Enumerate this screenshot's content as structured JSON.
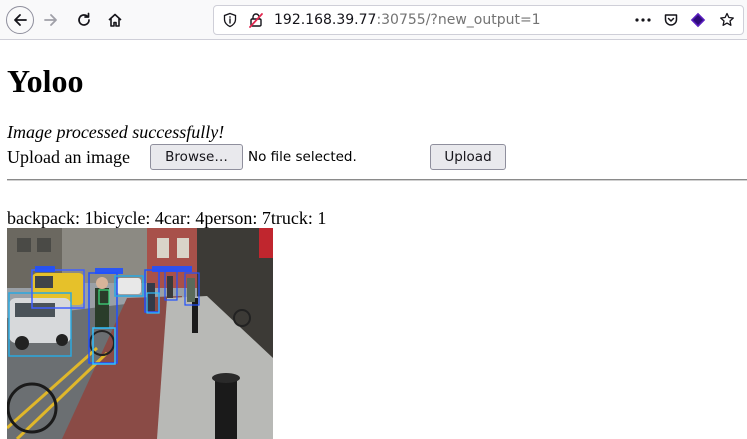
{
  "browser": {
    "url_host": "192.168.39.77",
    "url_rest": ":30755/?new_output=1"
  },
  "page": {
    "title": "Yoloo",
    "status_message": "Image processed successfully!",
    "upload_label": "Upload an image",
    "browse_label": "Browse…",
    "file_status": "No file selected.",
    "upload_button_label": "Upload",
    "detection_counts": "backpack: 1bicycle: 4car: 4person: 7truck: 1"
  },
  "detections": [
    {
      "label": "person",
      "color": "#2050ff"
    },
    {
      "label": "bicycle",
      "color": "#30c0ff"
    },
    {
      "label": "car",
      "color": "#2aa8e0"
    },
    {
      "label": "truck",
      "color": "#4060ff"
    },
    {
      "label": "backpack",
      "color": "#40e080"
    }
  ],
  "icons": {
    "back": "arrow-left-icon",
    "forward": "arrow-right-icon",
    "reload": "reload-icon",
    "home": "home-icon",
    "info": "info-icon",
    "insecure": "insecure-lock-icon",
    "more": "more-dots-icon",
    "pocket": "pocket-icon",
    "extension": "extension-icon",
    "bookmark": "star-icon"
  }
}
